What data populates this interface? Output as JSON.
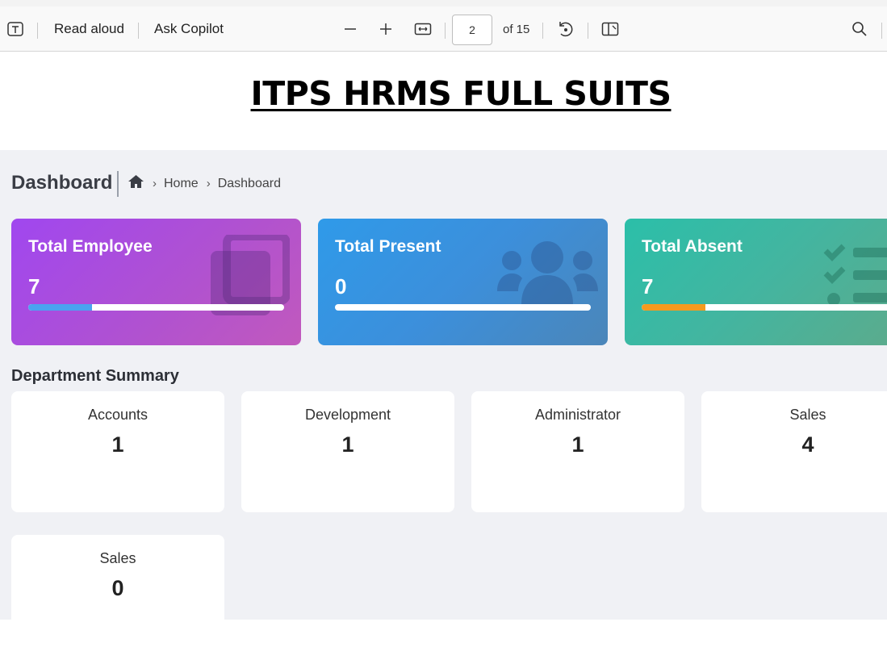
{
  "toolbar": {
    "read_aloud": "Read aloud",
    "ask_copilot": "Ask Copilot",
    "page_current": "2",
    "page_total": "of 15",
    "icons": [
      "text-format-icon",
      "zoom-out-icon",
      "zoom-in-icon",
      "fit-width-icon",
      "rotate-icon",
      "page-view-icon",
      "search-icon"
    ]
  },
  "document": {
    "title": "ITPS HRMS FULL SUITS"
  },
  "dashboard": {
    "title": "Dashboard",
    "breadcrumb": {
      "home": "Home",
      "current": "Dashboard"
    },
    "stats": [
      {
        "label": "Total Employee",
        "value": "7",
        "progress": 0.25,
        "bar_color": "#4aa3f0"
      },
      {
        "label": "Total Present",
        "value": "0",
        "progress": 0.0,
        "bar_color": "#ffffff"
      },
      {
        "label": "Total Absent",
        "value": "7",
        "progress": 0.25,
        "bar_color": "#f59a1e"
      }
    ],
    "department_summary": {
      "title": "Department Summary",
      "items": [
        {
          "name": "Accounts",
          "count": "1"
        },
        {
          "name": "Development",
          "count": "1"
        },
        {
          "name": "Administrator",
          "count": "1"
        },
        {
          "name": "Sales",
          "count": "4"
        },
        {
          "name": "Sales",
          "count": "0"
        }
      ]
    }
  }
}
